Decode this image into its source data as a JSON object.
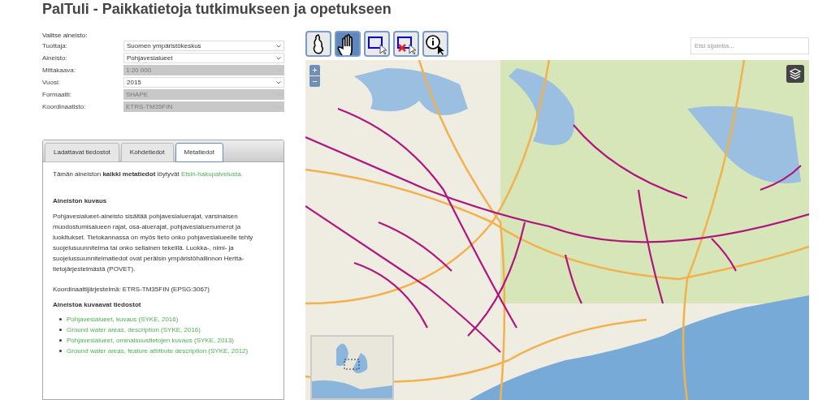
{
  "title": "PalTuli - Paikkatietoja tutkimukseen ja opetukseen",
  "form": {
    "heading": "Valitse aineisto:",
    "fields": [
      {
        "label": "Tuottaja:",
        "value": "Suomen ympäristökeskus",
        "disabled": false
      },
      {
        "label": "Aineisto:",
        "value": "Pohjavesialueet",
        "disabled": false
      },
      {
        "label": "Mittakaava:",
        "value": "1:20 000",
        "disabled": true
      },
      {
        "label": "Vuosi:",
        "value": "2015",
        "disabled": false
      },
      {
        "label": "Formaatti:",
        "value": "SHAPE",
        "disabled": true
      },
      {
        "label": "Koordinaatisto:",
        "value": "ETRS-TM35FIN",
        "disabled": true
      }
    ]
  },
  "tabs": [
    {
      "label": "Ladattavat tiedostot",
      "selected": false
    },
    {
      "label": "Kohdetiedot",
      "selected": false
    },
    {
      "label": "Metatiedot",
      "selected": true
    }
  ],
  "metadata": {
    "intro": "Tämän aineiston **kaikki metatiedot** löytyvät ",
    "intro_link": "Etsin-hakupalvelusta.",
    "description_heading": "Aineiston kuvaus",
    "description": "Pohjavesialueet-aineisto sisältää pohjavesialuerajat, varsinaisen muodostumisalueen rajat, osa-aluerajat, pohjavesialuenumerot ja luokitukset. Tietokannassa on myös tieto onko pohjavesialueelle tehty suojelusuunnitelma tai onko sellainen tekeillä. Luokka-, nimi- ja suojelussuunnitelmatiedot ovat peräisin ympäristöhallinnon Hertta-tietojärjestelmästä (POVET).",
    "coordinate_system": "Koordinaattijärjestelmä: ETRS-TM35FIN (EPSG:3067)",
    "files_heading": "Aineistoa kuvaavat tiedostot",
    "files": [
      "Pohjavesialueet, kuvaus (SYKE, 2016)",
      "Ground water areas, description (SYKE, 2016)",
      "Pohjavesialueet, ominaisuustietojen kuvaus (SYKE, 2013)",
      "Ground water areas, feature attribute description (SYKE, 2012)"
    ]
  },
  "toolbar": [
    {
      "kind": "extent",
      "selected": false
    },
    {
      "kind": "pan",
      "selected": true
    },
    {
      "kind": "select",
      "selected": false
    },
    {
      "kind": "deselect",
      "selected": false
    },
    {
      "kind": "info",
      "selected": false
    }
  ],
  "search": {
    "placeholder": "Etsi sijaintia..."
  },
  "map": {
    "zoom_in": "+",
    "zoom_out": "−"
  }
}
